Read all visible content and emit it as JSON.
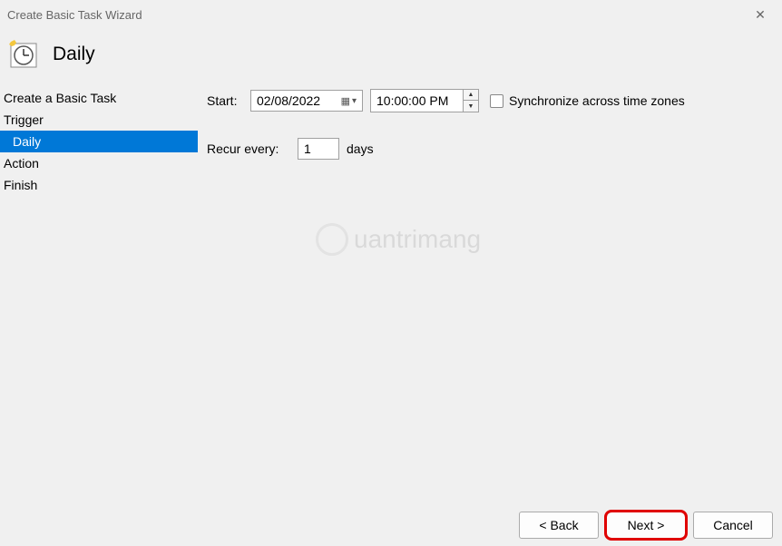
{
  "window": {
    "title": "Create Basic Task Wizard"
  },
  "header": {
    "title": "Daily"
  },
  "sidebar": {
    "items": [
      {
        "label": "Create a Basic Task",
        "selected": false,
        "indent": false
      },
      {
        "label": "Trigger",
        "selected": false,
        "indent": false
      },
      {
        "label": "Daily",
        "selected": true,
        "indent": true
      },
      {
        "label": "Action",
        "selected": false,
        "indent": false
      },
      {
        "label": "Finish",
        "selected": false,
        "indent": false
      }
    ]
  },
  "form": {
    "start_label": "Start:",
    "date_value": "02/08/2022",
    "time_value": "10:00:00 PM",
    "sync_label": "Synchronize across time zones",
    "sync_checked": false,
    "recur_label": "Recur every:",
    "recur_value": "1",
    "recur_unit": "days"
  },
  "footer": {
    "back": "< Back",
    "next": "Next >",
    "cancel": "Cancel"
  },
  "watermark": "uantrimang"
}
